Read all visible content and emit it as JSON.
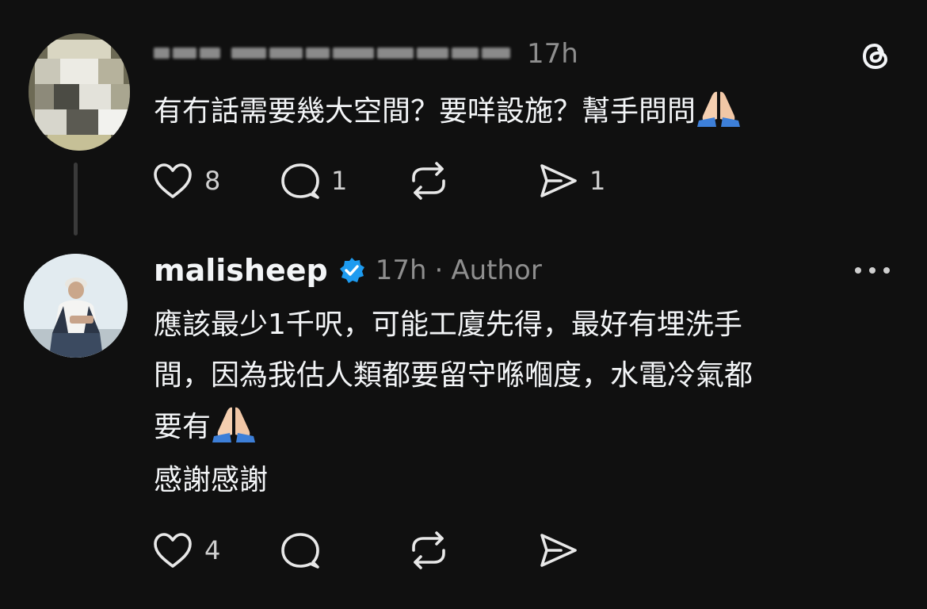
{
  "post1": {
    "username": "",
    "username_obscured": true,
    "time": "17h",
    "text": "有冇話需要幾大空間？要咩設施？幫手問問",
    "emoji": "folded-hands",
    "likes": "8",
    "replies": "1",
    "reposts": "",
    "shares": "1"
  },
  "post2": {
    "username": "malisheep",
    "verified": true,
    "time": "17h",
    "separator": "·",
    "badge": "Author",
    "lines": [
      "應該最少1千呎，可能工廈先得，最好有埋洗手",
      "間，因為我估人類都要留守喺嗰度，水電冷氣都",
      "要有"
    ],
    "emoji": "folded-hands",
    "line4": "感謝感謝",
    "likes": "4",
    "replies": "",
    "reposts": "",
    "shares": ""
  },
  "icons": {
    "like": "heart-icon",
    "reply": "comment-bubble-icon",
    "repost": "repost-icon",
    "share": "send-icon",
    "logo": "threads-logo-icon",
    "more": "more-options-icon",
    "verified": "verified-badge-icon"
  },
  "colors": {
    "background": "#101010",
    "text": "#f3f5f7",
    "muted": "#8e8e8e",
    "verified": "#1d9bf0"
  }
}
